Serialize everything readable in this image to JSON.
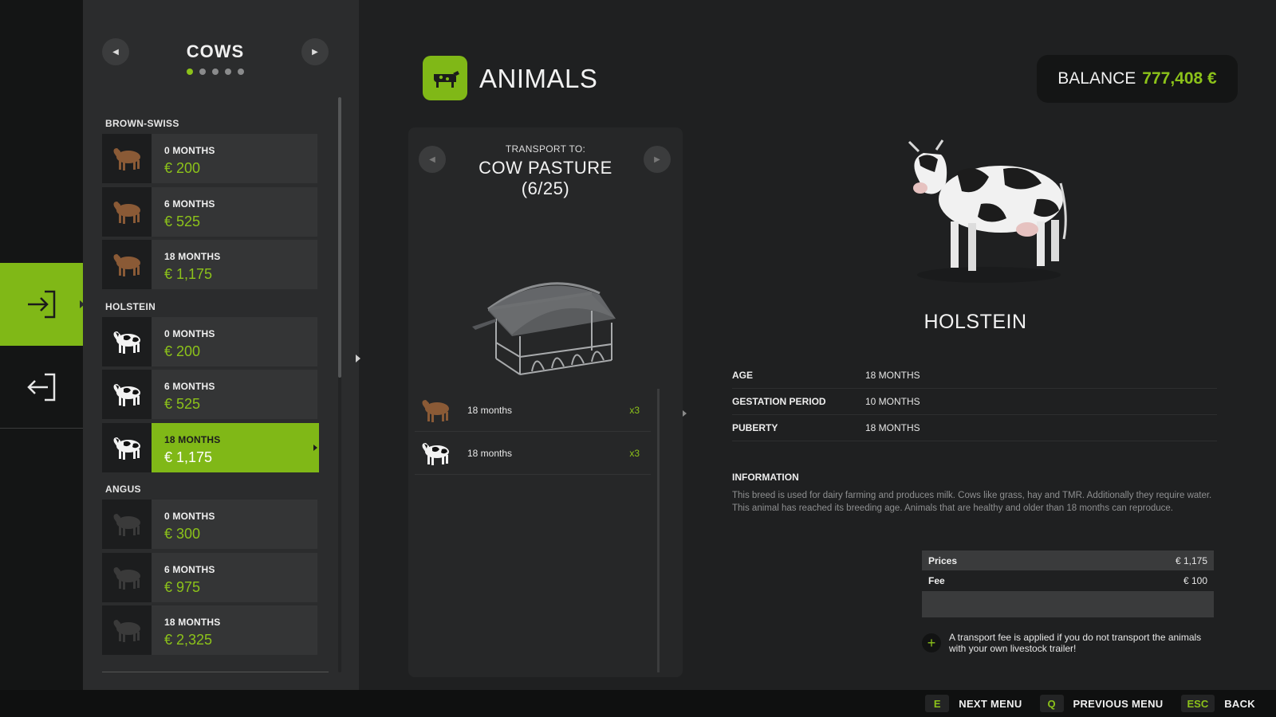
{
  "category": {
    "title": "COWS",
    "page_dots": 5,
    "active_dot": 0
  },
  "breeds": [
    {
      "name": "BROWN-SWISS",
      "color": "#8a5a36",
      "items": [
        {
          "age": "0 MONTHS",
          "price": "€ 200"
        },
        {
          "age": "6 MONTHS",
          "price": "€ 525"
        },
        {
          "age": "18 MONTHS",
          "price": "€ 1,175"
        }
      ]
    },
    {
      "name": "HOLSTEIN",
      "color": "#f2f2f2",
      "items": [
        {
          "age": "0 MONTHS",
          "price": "€ 200"
        },
        {
          "age": "6 MONTHS",
          "price": "€ 525"
        },
        {
          "age": "18 MONTHS",
          "price": "€ 1,175",
          "selected": true
        }
      ]
    },
    {
      "name": "ANGUS",
      "color": "#3a3a3a",
      "items": [
        {
          "age": "0 MONTHS",
          "price": "€ 300"
        },
        {
          "age": "6 MONTHS",
          "price": "€ 975"
        },
        {
          "age": "18 MONTHS",
          "price": "€ 2,325"
        }
      ]
    }
  ],
  "header": {
    "title": "ANIMALS",
    "icon": "cow-icon"
  },
  "balance": {
    "label": "BALANCE",
    "value": "777,408 €"
  },
  "transport": {
    "label": "TRANSPORT TO:",
    "destination": "COW PASTURE",
    "capacity": "(6/25)",
    "rows": [
      {
        "label": "18 months",
        "count": "x3",
        "color": "#8a5a36"
      },
      {
        "label": "18 months",
        "count": "x3",
        "color": "#f2f2f2"
      }
    ]
  },
  "detail": {
    "breed": "HOLSTEIN",
    "stats": [
      {
        "key": "AGE",
        "value": "18 MONTHS"
      },
      {
        "key": "GESTATION PERIOD",
        "value": "10 MONTHS"
      },
      {
        "key": "PUBERTY",
        "value": "18 MONTHS"
      }
    ],
    "info_title": "INFORMATION",
    "info_text": "This breed is used for dairy farming and produces milk. Cows like grass, hay and TMR. Additionally they require water. This animal has reached its breeding age. Animals that are healthy and older than 18 months can reproduce.",
    "fees": [
      {
        "key": "Prices",
        "value": "€ 1,175"
      },
      {
        "key": "Fee",
        "value": "€ 100"
      }
    ],
    "note": "A transport fee is applied if you do not transport the animals with your own livestock trailer!"
  },
  "hotkeys": [
    {
      "key": "E",
      "label": "NEXT MENU"
    },
    {
      "key": "Q",
      "label": "PREVIOUS MENU"
    },
    {
      "key": "ESC",
      "label": "BACK"
    }
  ],
  "colors": {
    "accent": "#80b817",
    "accent_text": "#8cc21a",
    "background": "#1f2021",
    "panel": "#2b2c2d"
  }
}
